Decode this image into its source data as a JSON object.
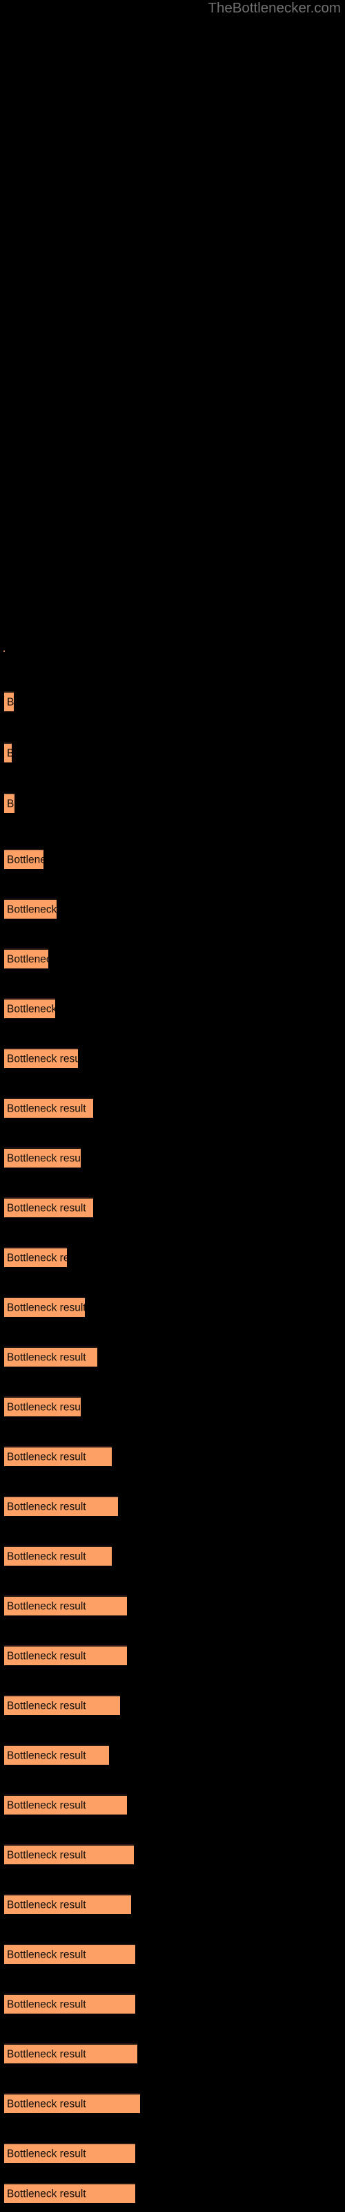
{
  "header": {
    "site_title": "TheBottlenecker.com"
  },
  "background_color": "#000000",
  "chart_data": {
    "type": "bar",
    "orientation": "horizontal",
    "title": "",
    "xlabel": "",
    "ylabel": "",
    "bar_color": "#fca066",
    "bar_border_color": "#241a12",
    "label_color": "#120d09",
    "grid": false,
    "legend": null,
    "axis_labels_visible": false,
    "tick_labels_visible": false,
    "bar_label_text": "Bottleneck result",
    "categories": [
      "Bottleneck result",
      "Bottleneck result",
      "Bottleneck result",
      "Bottleneck result",
      "Bottleneck result",
      "Bottleneck result",
      "Bottleneck result",
      "Bottleneck result",
      "Bottleneck result",
      "Bottleneck result",
      "Bottleneck result",
      "Bottleneck result",
      "Bottleneck result",
      "Bottleneck result",
      "Bottleneck result",
      "Bottleneck result",
      "Bottleneck result",
      "Bottleneck result",
      "Bottleneck result",
      "Bottleneck result",
      "Bottleneck result",
      "Bottleneck result",
      "Bottleneck result",
      "Bottleneck result",
      "Bottleneck result",
      "Bottleneck result",
      "Bottleneck result"
    ],
    "values": [
      14,
      11,
      15,
      57,
      76,
      64,
      74,
      107,
      129,
      111,
      129,
      111,
      81,
      135,
      156,
      152,
      156,
      163,
      168,
      152,
      178,
      184,
      174,
      190,
      197,
      190,
      190
    ],
    "xlim": [
      0,
      240
    ],
    "bar_tops": [
      1000,
      1043,
      1087,
      1130,
      1173,
      1216,
      1260,
      1303,
      1346,
      1390,
      1433,
      1476,
      1519,
      1563,
      1606,
      1649,
      1693,
      1736,
      1779,
      1822,
      1866,
      1909,
      1952,
      1996,
      2039,
      2082,
      2125
    ]
  },
  "bars": [
    {
      "label": "Bottleneck result",
      "width": 14,
      "top": 1000
    },
    {
      "label": "Bottleneck result",
      "width": 11,
      "top": 1074
    },
    {
      "label": "Bottleneck result",
      "width": 15,
      "top": 1147
    },
    {
      "label": "Bottleneck result",
      "width": 57,
      "top": 1228
    },
    {
      "label": "Bottleneck result",
      "width": 76,
      "top": 1300
    },
    {
      "label": "Bottleneck result",
      "width": 64,
      "top": 1372
    },
    {
      "label": "Bottleneck result",
      "width": 74,
      "top": 1444
    },
    {
      "label": "Bottleneck result",
      "width": 107,
      "top": 1516
    },
    {
      "label": "Bottleneck result",
      "width": 129,
      "top": 1588
    },
    {
      "label": "Bottleneck result",
      "width": 111,
      "top": 1660
    },
    {
      "label": "Bottleneck result",
      "width": 129,
      "top": 1732
    },
    {
      "label": "Bottleneck result",
      "width": 91,
      "top": 1804
    },
    {
      "label": "Bottleneck result",
      "width": 117,
      "top": 1876
    },
    {
      "label": "Bottleneck result",
      "width": 135,
      "top": 1948
    },
    {
      "label": "Bottleneck result",
      "width": 111,
      "top": 2020
    },
    {
      "label": "Bottleneck result",
      "width": 156,
      "top": 2092
    },
    {
      "label": "Bottleneck result",
      "width": 165,
      "top": 2164
    },
    {
      "label": "Bottleneck result",
      "width": 156,
      "top": 2236
    },
    {
      "label": "Bottleneck result",
      "width": 178,
      "top": 2308
    },
    {
      "label": "Bottleneck result",
      "width": 178,
      "top": 2380
    },
    {
      "label": "Bottleneck result",
      "width": 168,
      "top": 2452
    },
    {
      "label": "Bottleneck result",
      "width": 152,
      "top": 2524
    },
    {
      "label": "Bottleneck result",
      "width": 178,
      "top": 2596
    },
    {
      "label": "Bottleneck result",
      "width": 188,
      "top": 2668
    },
    {
      "label": "Bottleneck result",
      "width": 184,
      "top": 2740
    },
    {
      "label": "Bottleneck result",
      "width": 190,
      "top": 2812
    },
    {
      "label": "Bottleneck result",
      "width": 190,
      "top": 2884
    },
    {
      "label": "Bottleneck result",
      "width": 193,
      "top": 2956
    },
    {
      "label": "Bottleneck result",
      "width": 197,
      "top": 3028
    },
    {
      "label": "Bottleneck result",
      "width": 190,
      "top": 3100
    },
    {
      "label": "Bottleneck result",
      "width": 190,
      "top": 3158
    }
  ]
}
